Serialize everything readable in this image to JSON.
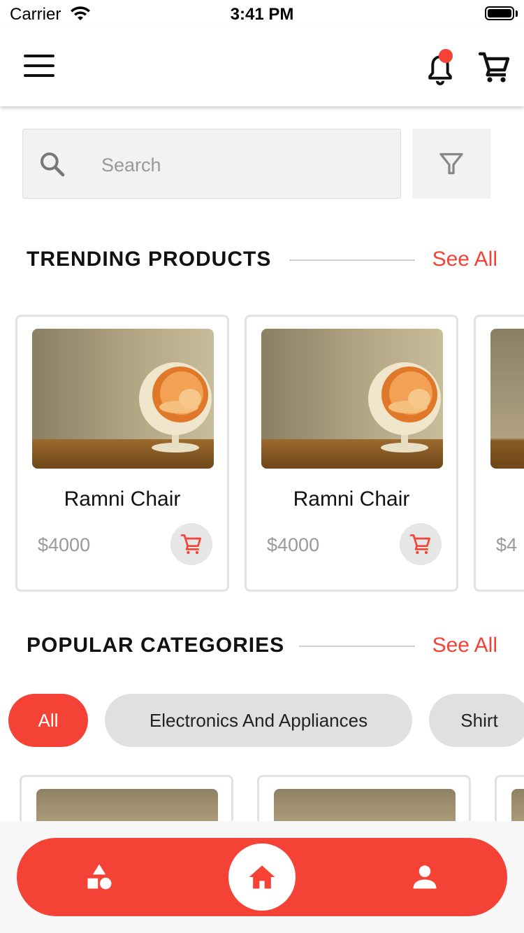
{
  "status_bar": {
    "carrier": "Carrier",
    "time": "3:41 PM"
  },
  "app_bar": {
    "menu_icon": "hamburger-menu-icon",
    "notification_icon": "bell-icon",
    "cart_icon": "shopping-cart-icon",
    "notification_dot_color": "#f44336"
  },
  "search": {
    "placeholder": "Search",
    "value": "",
    "icon": "search-icon",
    "filter_icon": "filter-funnel-icon"
  },
  "trending": {
    "title": "TRENDING PRODUCTS",
    "see_all": "See All",
    "products": [
      {
        "name": "Ramni Chair",
        "price": "$4000"
      },
      {
        "name": "Ramni Chair",
        "price": "$4000"
      },
      {
        "name": "",
        "price": "$4"
      }
    ]
  },
  "categories": {
    "title": "POPULAR CATEGORIES",
    "see_all": "See All",
    "chips": [
      {
        "label": "All",
        "active": true
      },
      {
        "label": "Electronics And Appliances",
        "active": false
      },
      {
        "label": "Shirt",
        "active": false
      }
    ]
  },
  "bottom_nav": {
    "items": [
      {
        "icon": "categories-shapes-icon"
      },
      {
        "icon": "home-icon",
        "active": true
      },
      {
        "icon": "person-icon"
      }
    ]
  },
  "colors": {
    "accent": "#f44336",
    "chip_inactive": "#e0e0e0",
    "price_text": "#9a9a9a"
  }
}
